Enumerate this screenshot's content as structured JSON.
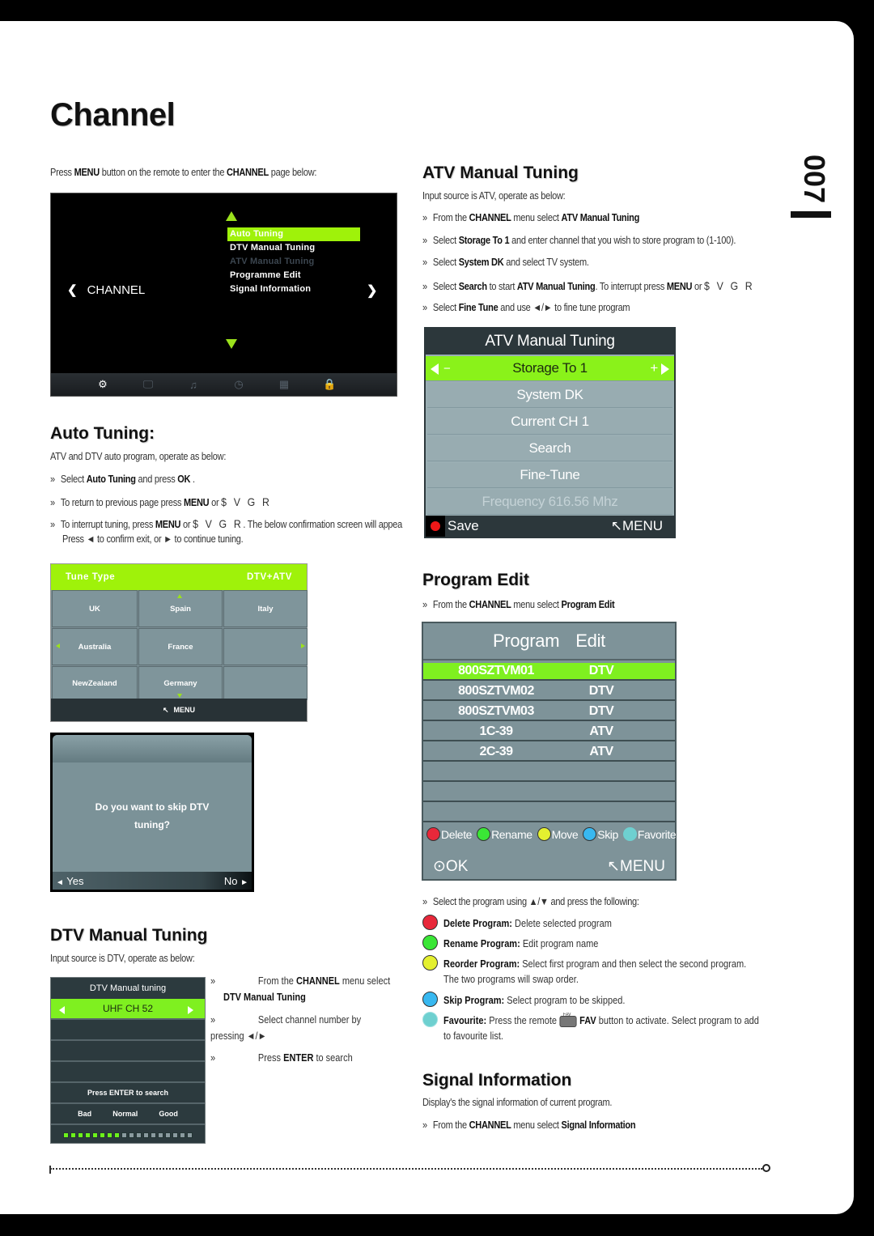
{
  "page": {
    "title": "Channel",
    "page_number": "007",
    "intro": {
      "prefix": "Press ",
      "b1": "MENU",
      "mid": " button on the remote to enter the ",
      "b2": "CHANNEL",
      "suffix": " page below:"
    }
  },
  "channel_menu": {
    "label": "CHANNEL",
    "left_chevron": "❮",
    "right_chevron": "❯",
    "items": [
      {
        "label": "Auto Tuning",
        "state": "selected"
      },
      {
        "label": "DTV Manual Tuning",
        "state": "normal"
      },
      {
        "label": "ATV Manual Tuning",
        "state": "disabled"
      },
      {
        "label": "Programme Edit",
        "state": "normal"
      },
      {
        "label": "Signal Information",
        "state": "normal"
      }
    ],
    "bottom_icons": [
      {
        "name": "settings-gear-icon",
        "glyph": "⚙",
        "active": true
      },
      {
        "name": "monitor-icon",
        "glyph": "🖵",
        "active": false
      },
      {
        "name": "music-note-icon",
        "glyph": "♫",
        "active": false
      },
      {
        "name": "clock-icon",
        "glyph": "◷",
        "active": false
      },
      {
        "name": "grid-icon",
        "glyph": "▦",
        "active": false
      },
      {
        "name": "lock-icon",
        "glyph": "🔒",
        "active": false
      }
    ]
  },
  "auto_tuning": {
    "heading": "Auto Tuning:",
    "desc": "ATV and DTV auto program, operate as below:",
    "bullets": [
      {
        "pre": "Select ",
        "b": "Auto Tuning",
        "post": " and press ",
        "b2": "OK",
        "post2": " ."
      },
      {
        "pre": "To return to previous page press ",
        "b": "MENU",
        "post": " or ",
        "sym": "$ V G R"
      },
      {
        "pre": "To interrupt tuning, press ",
        "b": "MENU",
        "post": " or ",
        "sym": "$ V G R",
        "post2": ". The below confirmation screen will appea"
      }
    ],
    "continuation": "Press ◄ to confirm exit, or ► to continue tuning.",
    "bullet_glyph": "»"
  },
  "tune_type": {
    "label": "Tune Type",
    "value": "DTV+ATV",
    "countries": [
      "UK",
      "Spain",
      "Italy",
      "Australia",
      "France",
      "",
      "NewZealand",
      "Germany",
      ""
    ],
    "footer": "MENU",
    "back_glyph": "↖"
  },
  "skip_dialog": {
    "message": "Do you want to skip DTV tuning?",
    "yes": "Yes",
    "no": "No",
    "yes_glyph": "◄",
    "no_glyph": "►"
  },
  "dtv_manual": {
    "heading": "DTV Manual Tuning",
    "desc": "Input source is DTV, operate as below:",
    "panel_title": "DTV Manual tuning",
    "channel": "UHF CH 52",
    "enter_hint": "Press ENTER to search",
    "quality_labels": [
      "Bad",
      "Normal",
      "Good"
    ],
    "signal_level": {
      "filled": 8,
      "total": 18
    },
    "steps": [
      {
        "pre": "From the ",
        "b": "CHANNEL",
        "post": " menu select",
        "line2_b": "DTV Manual Tuning"
      },
      {
        "pre": "Select channel number by",
        "line2": "pressing ◄/►"
      },
      {
        "pre": "Press ",
        "b": "ENTER",
        "post": " to search"
      }
    ]
  },
  "atv_manual": {
    "heading": "ATV Manual Tuning",
    "desc": "Input source is ATV, operate as below:",
    "bullets": [
      {
        "pre": "From the ",
        "b": "CHANNEL",
        "post": " menu select ",
        "b2": "ATV Manual Tuning",
        "post2": ""
      },
      {
        "pre": "Select ",
        "b": "Storage To 1",
        "post": " and enter channel that you wish to store program to (1-100).",
        "b2": "",
        "post2": ""
      },
      {
        "pre": "Select ",
        "b": "System DK",
        "post": " and select TV system.",
        "b2": "",
        "post2": ""
      },
      {
        "pre": "Select ",
        "b": "Search",
        "post": " to start ",
        "b2": "ATV Manual Tuning",
        "post2": ". To interrupt press ",
        "b3": "MENU",
        "post3": " or ",
        "sym": "$ V G R"
      },
      {
        "pre": "Select ",
        "b": "Fine Tune",
        "post": " and use ◄/► to fine tune program",
        "b2": "",
        "post2": ""
      }
    ],
    "panel": {
      "title": "ATV Manual Tuning",
      "storage": "Storage To 1",
      "minus": "−",
      "plus": "+",
      "rows": [
        "System DK",
        "Current CH 1",
        "Search",
        "Fine-Tune"
      ],
      "frequency": "Frequency 616.56 Mhz",
      "save": "Save",
      "menu": "MENU",
      "back_glyph": "↖"
    }
  },
  "program_edit": {
    "heading": "Program Edit",
    "bullet": {
      "pre": "From the ",
      "b": "CHANNEL",
      "post": " menu select ",
      "b2": "Program Edit"
    },
    "panel": {
      "title_a": "Program",
      "title_b": "Edit",
      "programs": [
        {
          "name": "800SZTVM01",
          "type": "DTV",
          "selected": true
        },
        {
          "name": "800SZTVM02",
          "type": "DTV",
          "selected": false
        },
        {
          "name": "800SZTVM03",
          "type": "DTV",
          "selected": false
        },
        {
          "name": "1C-39",
          "type": "ATV",
          "selected": false
        },
        {
          "name": "2C-39",
          "type": "ATV",
          "selected": false
        }
      ],
      "legend": [
        {
          "label": "Delete",
          "color": "#e8283a"
        },
        {
          "label": "Rename",
          "color": "#3ae636"
        },
        {
          "label": "Move",
          "color": "#e4f030"
        },
        {
          "label": "Skip",
          "color": "#38b8f0"
        },
        {
          "label": "Favorite",
          "color": "#6ed0d0"
        }
      ],
      "ok": "OK",
      "ok_glyph": "⊙",
      "menu": "MENU",
      "back_glyph": "↖"
    },
    "select_line": "Select the program using ▲/▼ and press the following:",
    "keys": [
      {
        "color": "#e8283a",
        "b": "Delete Program:",
        "text": " Delete selected program"
      },
      {
        "color": "#3ae636",
        "b": "Rename Program:",
        "text": " Edit program name"
      },
      {
        "color": "#e4f030",
        "b": "Reorder Program:",
        "text": " Select first program and then select the second program.",
        "line2": "The two programs will swap order."
      },
      {
        "color": "#38b8f0",
        "b": "Skip Program:",
        "text": " Select program to be skipped."
      },
      {
        "color": "#6ed0d0",
        "b": "Favourite:",
        "text": " Press the remote",
        "fav_cap": "FAV",
        "b2": "FAV",
        "text2": " button to activate. Select program to add",
        "line2": "to favourite list."
      }
    ]
  },
  "signal_info": {
    "heading": "Signal Information",
    "desc": "Display's the signal information of current program.",
    "bullet": {
      "pre": "From the ",
      "b": "CHANNEL",
      "post": " menu select ",
      "b2": "Signal Information"
    }
  }
}
